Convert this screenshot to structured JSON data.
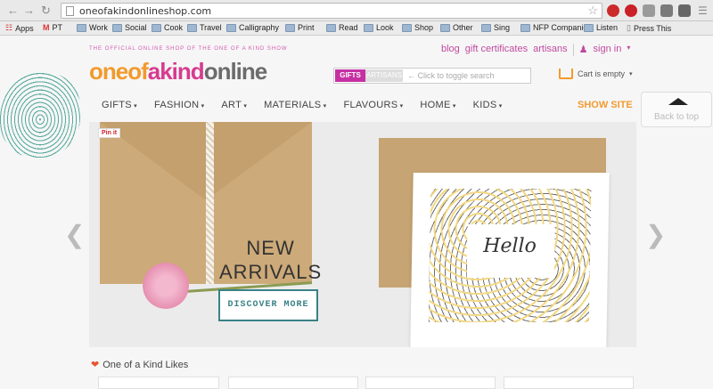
{
  "browser": {
    "url": "oneofakindonlineshop.com",
    "back_icon": "arrow-left",
    "forward_icon": "arrow-right",
    "reload_icon": "reload",
    "star_icon": "star"
  },
  "bookmarks": [
    {
      "label": "Apps",
      "icon": "apps-grid"
    },
    {
      "label": "PT",
      "icon": "gmail"
    },
    {
      "label": "Work",
      "icon": "folder"
    },
    {
      "label": "Social",
      "icon": "folder"
    },
    {
      "label": "Cook",
      "icon": "folder"
    },
    {
      "label": "Travel",
      "icon": "folder"
    },
    {
      "label": "Calligraphy",
      "icon": "folder"
    },
    {
      "label": "Print",
      "icon": "folder"
    },
    {
      "label": "Read",
      "icon": "folder"
    },
    {
      "label": "Look",
      "icon": "folder"
    },
    {
      "label": "Shop",
      "icon": "folder"
    },
    {
      "label": "Other",
      "icon": "folder"
    },
    {
      "label": "Sing",
      "icon": "folder"
    },
    {
      "label": "NFP Companies",
      "icon": "folder"
    },
    {
      "label": "Listen",
      "icon": "folder"
    },
    {
      "label": "Press This",
      "icon": "page"
    }
  ],
  "site": {
    "tagline": "THE OFFICIAL ONLINE SHOP OF THE ONE OF A KIND SHOW",
    "logo": {
      "part1": "oneof",
      "part2": "akind",
      "part3": "online"
    },
    "toplinks": {
      "blog": "blog",
      "gift_certificates": "gift certificates",
      "artisans": "artisans",
      "sign_in": "sign in"
    },
    "search": {
      "tab_gifts": "GIFTS",
      "tab_artisans": "ARTISANS",
      "placeholder": "← Click to toggle search"
    },
    "cart": {
      "label": "Cart is empty"
    },
    "menu": [
      "GIFTS",
      "FASHION",
      "ART",
      "MATERIALS",
      "FLAVOURS",
      "HOME",
      "KIDS"
    ],
    "show_site": "SHOW SITE",
    "back_to_top": "Back to top",
    "hero": {
      "pinit": "Pin it",
      "headline_line1": "NEW",
      "headline_line2": "ARRIVALS",
      "cta": "DISCOVER MORE",
      "card_text": "Hello"
    },
    "likes_title": "One of a Kind Likes"
  },
  "colors": {
    "accent_pink": "#c630a3",
    "accent_orange": "#f29a2e",
    "teal": "#3a8287"
  }
}
